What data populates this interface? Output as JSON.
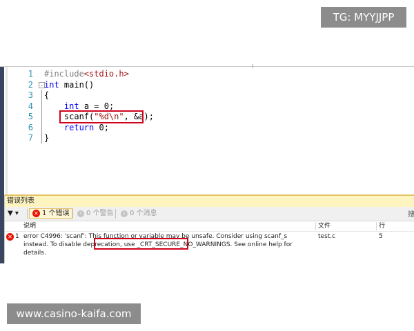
{
  "watermark_top": "TG: MYYJJPP",
  "watermark_bottom": "www.casino-kaifa.com",
  "editor": {
    "lines": [
      {
        "n": "1",
        "parts": [
          {
            "t": "#include",
            "c": "pp"
          },
          {
            "t": "<stdio.h>",
            "c": "inc"
          }
        ]
      },
      {
        "n": "2",
        "parts": [
          {
            "t": "int",
            "c": "kw"
          },
          {
            "t": " main()",
            "c": ""
          }
        ]
      },
      {
        "n": "3",
        "parts": [
          {
            "t": "{",
            "c": ""
          }
        ]
      },
      {
        "n": "4",
        "parts": [
          {
            "t": "    ",
            "c": ""
          },
          {
            "t": "int",
            "c": "kw"
          },
          {
            "t": " a = 0;",
            "c": ""
          }
        ]
      },
      {
        "n": "5",
        "parts": [
          {
            "t": "    scanf(",
            "c": ""
          },
          {
            "t": "\"%d\\n\"",
            "c": "str"
          },
          {
            "t": ", &a);",
            "c": ""
          }
        ]
      },
      {
        "n": "6",
        "parts": [
          {
            "t": "    ",
            "c": ""
          },
          {
            "t": "return",
            "c": "kw"
          },
          {
            "t": " 0;",
            "c": ""
          }
        ]
      },
      {
        "n": "7",
        "parts": [
          {
            "t": "}",
            "c": ""
          }
        ]
      }
    ]
  },
  "error_list": {
    "title": "错误列表",
    "filter_icon": "filter-icon",
    "errors_label": "1 个错误",
    "warnings_label": "0 个警告",
    "messages_label": "0 个消息",
    "columns": {
      "desc": "说明",
      "file": "文件",
      "line": "行"
    },
    "rows": [
      {
        "num": "1",
        "desc_before": "error C4996: 'scanf': This function or variable may be unsafe. Consider using scanf_s instead. To disable deprecation, use ",
        "desc_highlight": "_CRT_SECURE_NO_WARNINGS.",
        "desc_after": " See online help for details.",
        "file": "test.c",
        "line": "5"
      }
    ]
  },
  "colors": {
    "keyword": "#0000ff",
    "string": "#a31515",
    "highlight": "#d0021b",
    "error": "#e51400"
  }
}
